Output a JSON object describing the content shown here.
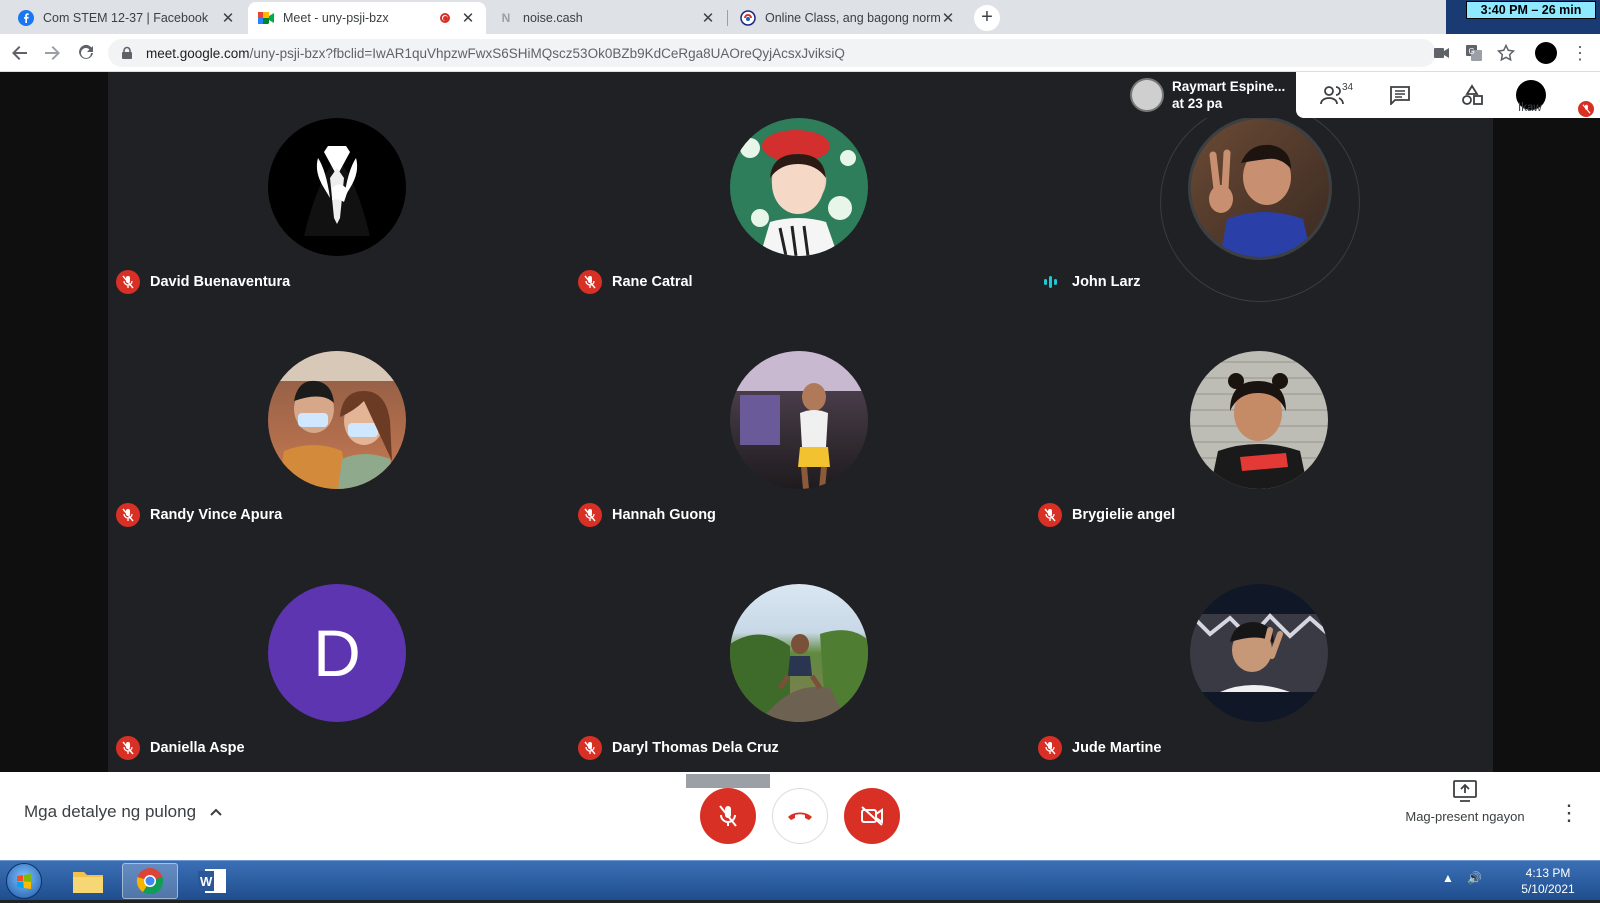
{
  "browser": {
    "tabs": [
      {
        "title": "Com STEM 12-37 | Facebook",
        "icon": "facebook-icon",
        "active": false
      },
      {
        "title": "Meet - uny-psji-bzx",
        "icon": "google-meet-icon",
        "active": true,
        "recording": true
      },
      {
        "title": "noise.cash",
        "icon": "noise-cash-icon",
        "active": false
      },
      {
        "title": "Online Class, ang bagong normal",
        "icon": "site-icon",
        "active": false
      }
    ],
    "timer_text": "3:40 PM – 26 min",
    "url_host": "meet.google.com",
    "url_path": "/uny-psji-bzx?fbclid=IwAR1quVhpzwFwxS6SHiMQscz53Ok0BZb9KdCeRga8UAOreQyjAcsxJviksiQ"
  },
  "meet": {
    "participants": [
      {
        "name": "David Buenaventura",
        "avatar": "anonymous-suit-image",
        "mic": "off"
      },
      {
        "name": "Rane Catral",
        "avatar": "photo",
        "mic": "off"
      },
      {
        "name": "John Larz",
        "avatar": "photo",
        "mic": "speaking"
      },
      {
        "name": "Randy Vince Apura",
        "avatar": "photo",
        "mic": "off"
      },
      {
        "name": "Hannah Guong",
        "avatar": "photo",
        "mic": "off"
      },
      {
        "name": "Brygielie angel",
        "avatar": "photo",
        "mic": "off"
      },
      {
        "name": "Daniella Aspe",
        "avatar_letter": "D",
        "mic": "off"
      },
      {
        "name": "Daryl Thomas Dela Cruz",
        "avatar": "photo",
        "mic": "off"
      },
      {
        "name": "Jude Martine",
        "avatar": "photo",
        "mic": "off"
      }
    ],
    "presenter": {
      "line1": "Raymart Espine...",
      "line2": "at 23 pa"
    },
    "people_count": "34",
    "self_label": "Ikaw",
    "meeting_details_label": "Mga detalye ng pulong",
    "present_label": "Mag-present ngayon",
    "colors": {
      "mic_off": "#d93025",
      "speaking": "#1ec8d7",
      "stage": "#202124",
      "letter_avatar": "#5e35b1"
    }
  },
  "taskbar": {
    "apps": [
      "file-explorer-icon",
      "chrome-icon",
      "word-icon"
    ],
    "time": "4:13 PM",
    "date": "5/10/2021"
  }
}
